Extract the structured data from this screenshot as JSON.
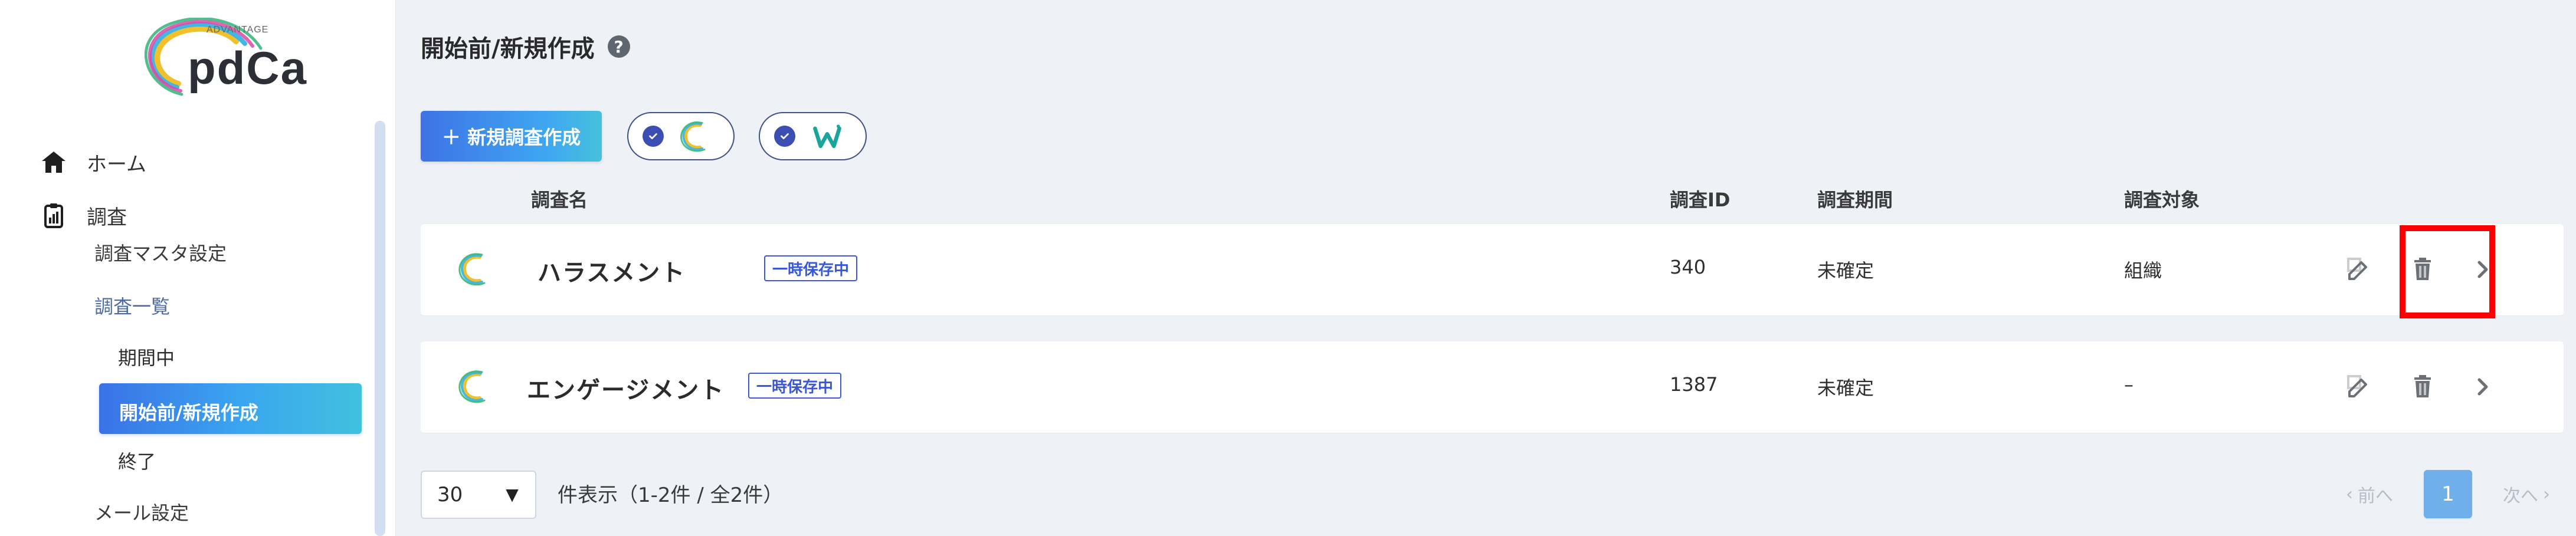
{
  "app": {
    "brand_small": "ADVANTAGE",
    "brand_name": "pdCa"
  },
  "sidebar": {
    "items": [
      {
        "label": "ホーム",
        "icon": "home-icon"
      },
      {
        "label": "調査",
        "icon": "clipboard-icon"
      }
    ],
    "survey_sub": {
      "master": "調査マスタ設定",
      "list": "調査一覧",
      "ongoing": "期間中",
      "active": "開始前/新規作成",
      "finished": "終了",
      "mail": "メール設定"
    }
  },
  "main": {
    "title": "開始前/新規作成",
    "help_icon_label": "?",
    "new_button": "＋ 新規調査作成",
    "filters": [
      {
        "logo": "advantage-c-logo-icon"
      },
      {
        "logo": "w-logo-icon"
      }
    ],
    "table": {
      "headers": {
        "name": "調査名",
        "id": "調査ID",
        "period": "調査期間",
        "target": "調査対象"
      },
      "rows": [
        {
          "name": "ハラスメント",
          "badge": "一時保存中",
          "id": "340",
          "period": "未確定",
          "target": "組織"
        },
        {
          "name": "エンゲージメント",
          "badge": "一時保存中",
          "id": "1387",
          "period": "未確定",
          "target": "–"
        }
      ]
    },
    "pagination": {
      "page_size": "30",
      "range_text": "件表示（1-2件 / 全2件）",
      "prev": "前へ",
      "current": "1",
      "next": "次へ"
    }
  },
  "colors": {
    "primary": "#4a86e8",
    "highlight": "#ff0000",
    "active_gradient_start": "#3a72e6",
    "active_gradient_end": "#41c0dd"
  }
}
